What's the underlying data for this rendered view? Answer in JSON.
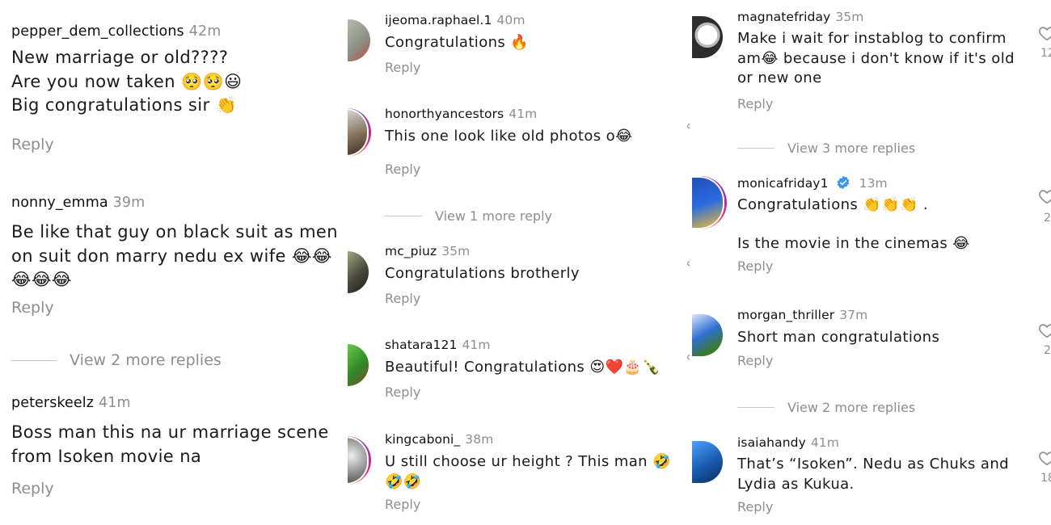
{
  "panel1": {
    "c1": {
      "user": "pepper_dem_collections",
      "time": "42m",
      "l1": "New marriage or old????",
      "l2": "Are you now taken 🥺🥺😃",
      "l3": "Big congratulations sir 👏",
      "reply": "Reply"
    },
    "c2": {
      "user": "nonny_emma",
      "time": "39m",
      "l1": "Be like that guy on black suit as men",
      "l2": "on suit don marry nedu ex wife 😂😂",
      "l3": "😂😂😂",
      "reply": "Reply"
    },
    "more": "View 2 more replies",
    "c3": {
      "user": "peterskeelz",
      "time": "41m",
      "l1": "Boss man this na ur marriage scene",
      "l2": "from Isoken movie na",
      "reply": "Reply"
    }
  },
  "panel2": {
    "c1": {
      "user": "ijeoma.raphael.1",
      "time": "40m",
      "l1": "Congratulations 🔥",
      "reply": "Reply"
    },
    "c2": {
      "user": "honorthyancestors",
      "time": "41m",
      "l1": "This one look like old photos o😂",
      "reply": "Reply"
    },
    "more": "View 1 more reply",
    "c3": {
      "user": "mc_piuz",
      "time": "35m",
      "l1": "Congratulations brotherly",
      "reply": "Reply"
    },
    "c4": {
      "user": "shatara121",
      "time": "41m",
      "l1": "Beautiful!  Congratulations 😍❤️🎂🍾",
      "reply": "Reply"
    },
    "c5": {
      "user": "kingcaboni_",
      "time": "38m",
      "l1": "U still choose ur height ? This man 🤣",
      "l2": "🤣🤣",
      "reply": "Reply"
    }
  },
  "panel3": {
    "c1": {
      "user": "magnatefriday",
      "time": "35m",
      "l1": "Make i wait for instablog to confirm",
      "l2": "am😂 because i don't know if it's old",
      "l3": "or new one",
      "reply": "Reply"
    },
    "more1": "View 3 more replies",
    "c2": {
      "user": "monicafriday1",
      "time": "13m",
      "l1": "Congratulations 👏👏👏 .",
      "l2": "Is the movie in the cinemas 😂",
      "reply": "Reply"
    },
    "c3": {
      "user": "morgan_thriller",
      "time": "37m",
      "l1": "Short man congratulations",
      "reply": "Reply"
    },
    "more2": "View 2 more replies",
    "c4": {
      "user": "isaiahandy",
      "time": "41m",
      "l1": "That’s “Isoken”. Nedu as Chuks and",
      "l2": "Lydia as Kukua.",
      "reply": "Reply"
    }
  },
  "side": {
    "count1": "12",
    "count2": "2",
    "count3": "2",
    "count4": "18"
  },
  "colors": {
    "meta": "#8e8e8e",
    "text": "#1a1a1a",
    "verified": "#3897f0"
  }
}
